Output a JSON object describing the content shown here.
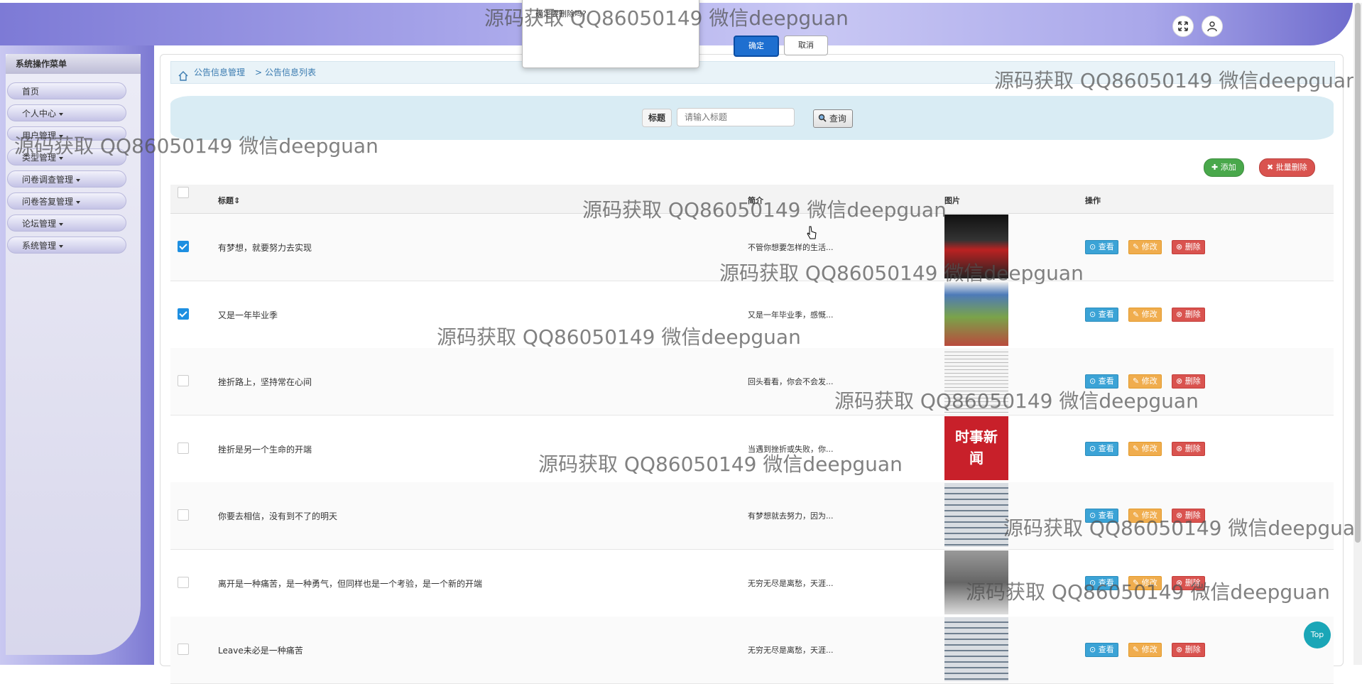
{
  "dialog": {
    "message": "确定要删除吗?",
    "ok_label": "确定",
    "cancel_label": "取消"
  },
  "sidebar": {
    "title": "系统操作菜单",
    "items": [
      {
        "label": "首页"
      },
      {
        "label": "个人中心"
      },
      {
        "label": "用户管理"
      },
      {
        "label": "类型管理"
      },
      {
        "label": "问卷调查管理"
      },
      {
        "label": "问卷答复管理"
      },
      {
        "label": "论坛管理"
      },
      {
        "label": "系统管理"
      }
    ]
  },
  "breadcrumb": {
    "level1": "公告信息管理",
    "sep": ">",
    "level2": "公告信息列表"
  },
  "search": {
    "label": "标题",
    "placeholder": "请输入标题",
    "button": "查询"
  },
  "actions": {
    "add": "添加",
    "batch_delete": "批量删除"
  },
  "table": {
    "headers": {
      "title": "标题",
      "intro": "简介",
      "image": "图片",
      "ops": "操作"
    },
    "row_buttons": {
      "view": "查看",
      "edit": "修改",
      "delete": "删除"
    },
    "rows": [
      {
        "checked": true,
        "title": "有梦想，就要努力去实现",
        "intro": "不管你想要怎样的生活..."
      },
      {
        "checked": true,
        "title": "又是一年毕业季",
        "intro": "又是一年毕业季，感慨..."
      },
      {
        "checked": false,
        "title": "挫折路上，坚持常在心间",
        "intro": "回头看看，你会不会发..."
      },
      {
        "checked": false,
        "title": "挫折是另一个生命的开端",
        "intro": "当遇到挫折或失败，你..."
      },
      {
        "checked": false,
        "title": "你要去相信，没有到不了的明天",
        "intro": "有梦想就去努力，因为..."
      },
      {
        "checked": false,
        "title": "离开是一种痛苦，是一种勇气，但同样也是一个考验，是一个新的开端",
        "intro": "无穷无尽是离愁，天涯..."
      },
      {
        "checked": false,
        "title": "Leave未必是一种痛苦",
        "intro": "无穷无尽是离愁，天涯..."
      }
    ],
    "thumbnail_4_text": "时事新闻"
  },
  "watermark": "源码获取 QQ86050149 微信deepguan",
  "top_button": "Top"
}
